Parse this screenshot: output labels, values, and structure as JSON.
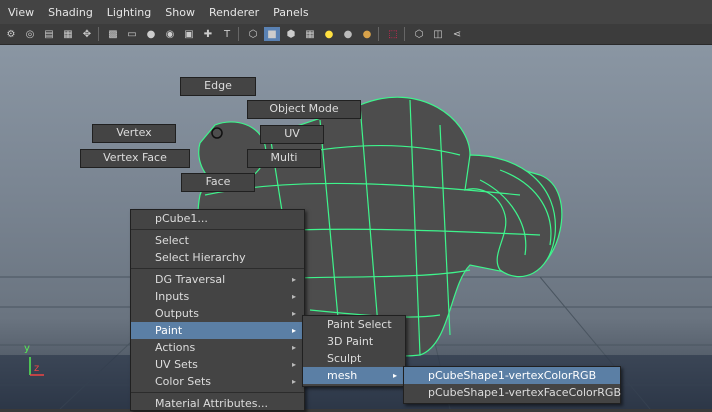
{
  "menubar": [
    "View",
    "Shading",
    "Lighting",
    "Show",
    "Renderer",
    "Panels"
  ],
  "marking_menu": {
    "north": "Edge",
    "northeast": "Object Mode",
    "west": "Vertex",
    "east": "UV",
    "southwest": "Vertex Face",
    "southeast": "Multi",
    "south": "Face"
  },
  "context_menu": {
    "header": "pCube1...",
    "items": [
      {
        "label": "Select"
      },
      {
        "label": "Select Hierarchy"
      },
      {
        "label": "DG Traversal"
      },
      {
        "label": "Inputs"
      },
      {
        "label": "Outputs"
      },
      {
        "label": "Paint"
      },
      {
        "label": "Actions"
      },
      {
        "label": "UV Sets"
      },
      {
        "label": "Color Sets"
      },
      {
        "label": "Material Attributes..."
      }
    ]
  },
  "paint_submenu": [
    "Paint Select",
    "3D Paint",
    "Sculpt",
    "mesh"
  ],
  "mesh_submenu": [
    "pCubeShape1-vertexColorRGB",
    "pCubeShape1-vertexFaceColorRGB"
  ],
  "axis": {
    "y": "y",
    "x": "x",
    "z": "z"
  },
  "colors": {
    "wireframe": "#3ef58c",
    "highlight": "#5b7fa5"
  }
}
